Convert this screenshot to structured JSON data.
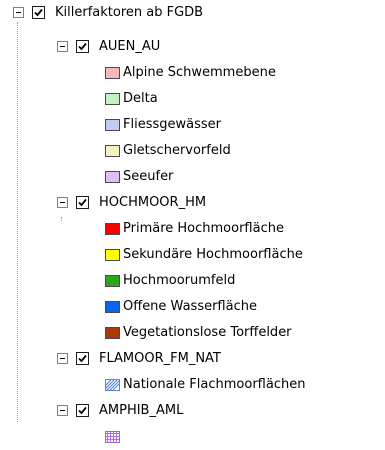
{
  "root": {
    "label": "Killerfaktoren ab FGDB",
    "checked": true
  },
  "groups": [
    {
      "label": "AUEN_AU",
      "checked": true,
      "items": [
        {
          "label": "Alpine Schwemmebene",
          "color": "#f5b8b8",
          "icon": "solid-swatch"
        },
        {
          "label": "Delta",
          "color": "#c5f0c3",
          "icon": "solid-swatch"
        },
        {
          "label": "Fliessgewässer",
          "color": "#bfcdf4",
          "icon": "solid-swatch"
        },
        {
          "label": "Gletschervorfeld",
          "color": "#f6f2bf",
          "icon": "solid-swatch"
        },
        {
          "label": "Seeufer",
          "color": "#e0bff3",
          "icon": "solid-swatch"
        }
      ]
    },
    {
      "label": "HOCHMOOR_HM",
      "checked": true,
      "items": [
        {
          "label": "Primäre Hochmoorfläche",
          "color": "#ff0000",
          "icon": "solid-swatch"
        },
        {
          "label": "Sekundäre Hochmoorfläche",
          "color": "#ffff00",
          "icon": "solid-swatch"
        },
        {
          "label": "Hochmoorumfeld",
          "color": "#2da61c",
          "icon": "solid-swatch"
        },
        {
          "label": "Offene Wasserfläche",
          "color": "#0a64f0",
          "icon": "solid-swatch"
        },
        {
          "label": "Vegetationslose Torffelder",
          "color": "#a83a0c",
          "icon": "solid-swatch"
        }
      ]
    },
    {
      "label": "FLAMOOR_FM_NAT",
      "checked": true,
      "items": [
        {
          "label": "Nationale Flachmoorflächen",
          "color": "#7aa6f0",
          "icon": "hatched-swatch"
        }
      ]
    },
    {
      "label": "AMPHIB_AML",
      "checked": true,
      "items": [
        {
          "label": "",
          "color": "#b46cf0",
          "icon": "grid-swatch"
        }
      ]
    }
  ]
}
